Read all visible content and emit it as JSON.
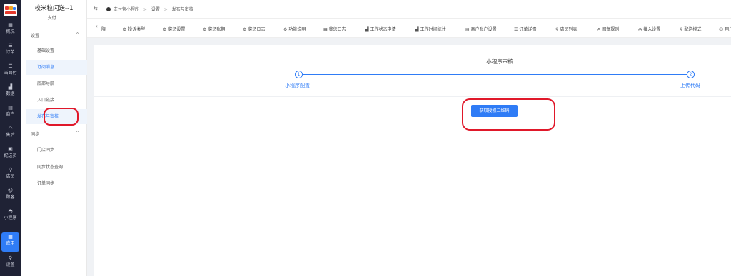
{
  "rail": {
    "items": [
      {
        "icon": "dashboard-icon",
        "glyph": "▦",
        "label": "概况"
      },
      {
        "icon": "list-icon",
        "glyph": "☰",
        "label": "订单"
      },
      {
        "icon": "list-icon",
        "glyph": "☰",
        "label": "当面付"
      },
      {
        "icon": "bar-chart-icon",
        "glyph": "▟",
        "label": "数据"
      },
      {
        "icon": "store-icon",
        "glyph": "▤",
        "label": "商户"
      },
      {
        "icon": "headset-icon",
        "glyph": "◠",
        "label": "售后"
      },
      {
        "icon": "rider-icon",
        "glyph": "▣",
        "label": "配送员"
      },
      {
        "icon": "user-icon",
        "glyph": "⚲",
        "label": "店员"
      },
      {
        "icon": "customer-icon",
        "glyph": "☺",
        "label": "顾客"
      },
      {
        "icon": "chat-icon",
        "glyph": "◓",
        "label": "小程序"
      },
      {
        "icon": "apps-icon",
        "glyph": "▦",
        "label": "应用"
      },
      {
        "icon": "settings-icon",
        "glyph": "⚲",
        "label": "设置"
      }
    ]
  },
  "sidebar": {
    "store_title": "校米粒闪送--1",
    "store_sub": "支付...",
    "group1": "设置",
    "group1_items": [
      "基础设置",
      "订阅消息",
      "底部导航",
      "入口链接",
      "发布与审核"
    ],
    "group2": "同步",
    "group2_items": [
      "门店同步",
      "同步状态查询",
      "订单同步"
    ]
  },
  "header": {
    "collapse": "⇆",
    "crumbs": [
      "支付宝小程序",
      "设置",
      "发布与审核"
    ]
  },
  "tabs": {
    "prev": "‹",
    "items": [
      {
        "label": "限",
        "glyph": ""
      },
      {
        "label": "投诉类型",
        "glyph": "⚙"
      },
      {
        "label": "奖惩设置",
        "glyph": "⚙"
      },
      {
        "label": "奖惩账期",
        "glyph": "⚙"
      },
      {
        "label": "奖惩日志",
        "glyph": "⚙"
      },
      {
        "label": "功能说明",
        "glyph": "⚙"
      },
      {
        "label": "奖惩日志",
        "glyph": "▦"
      },
      {
        "label": "工作状态申请",
        "glyph": "▟"
      },
      {
        "label": "工作时间统计",
        "glyph": "▟"
      },
      {
        "label": "商户账户设置",
        "glyph": "▤"
      },
      {
        "label": "订单详情",
        "glyph": "☰"
      },
      {
        "label": "店员列表",
        "glyph": "⚲"
      },
      {
        "label": "回复规则",
        "glyph": "◓"
      },
      {
        "label": "接入设置",
        "glyph": "◓"
      },
      {
        "label": "配送模式",
        "glyph": "⚲"
      },
      {
        "label": "用户",
        "glyph": "☺"
      }
    ]
  },
  "main": {
    "steps_title": "小程序审核",
    "step1_num": "1",
    "step1_label": "小程序配置",
    "step2_num": "2",
    "step2_label": "上传代码",
    "qr_button": "获取授权二维码"
  }
}
